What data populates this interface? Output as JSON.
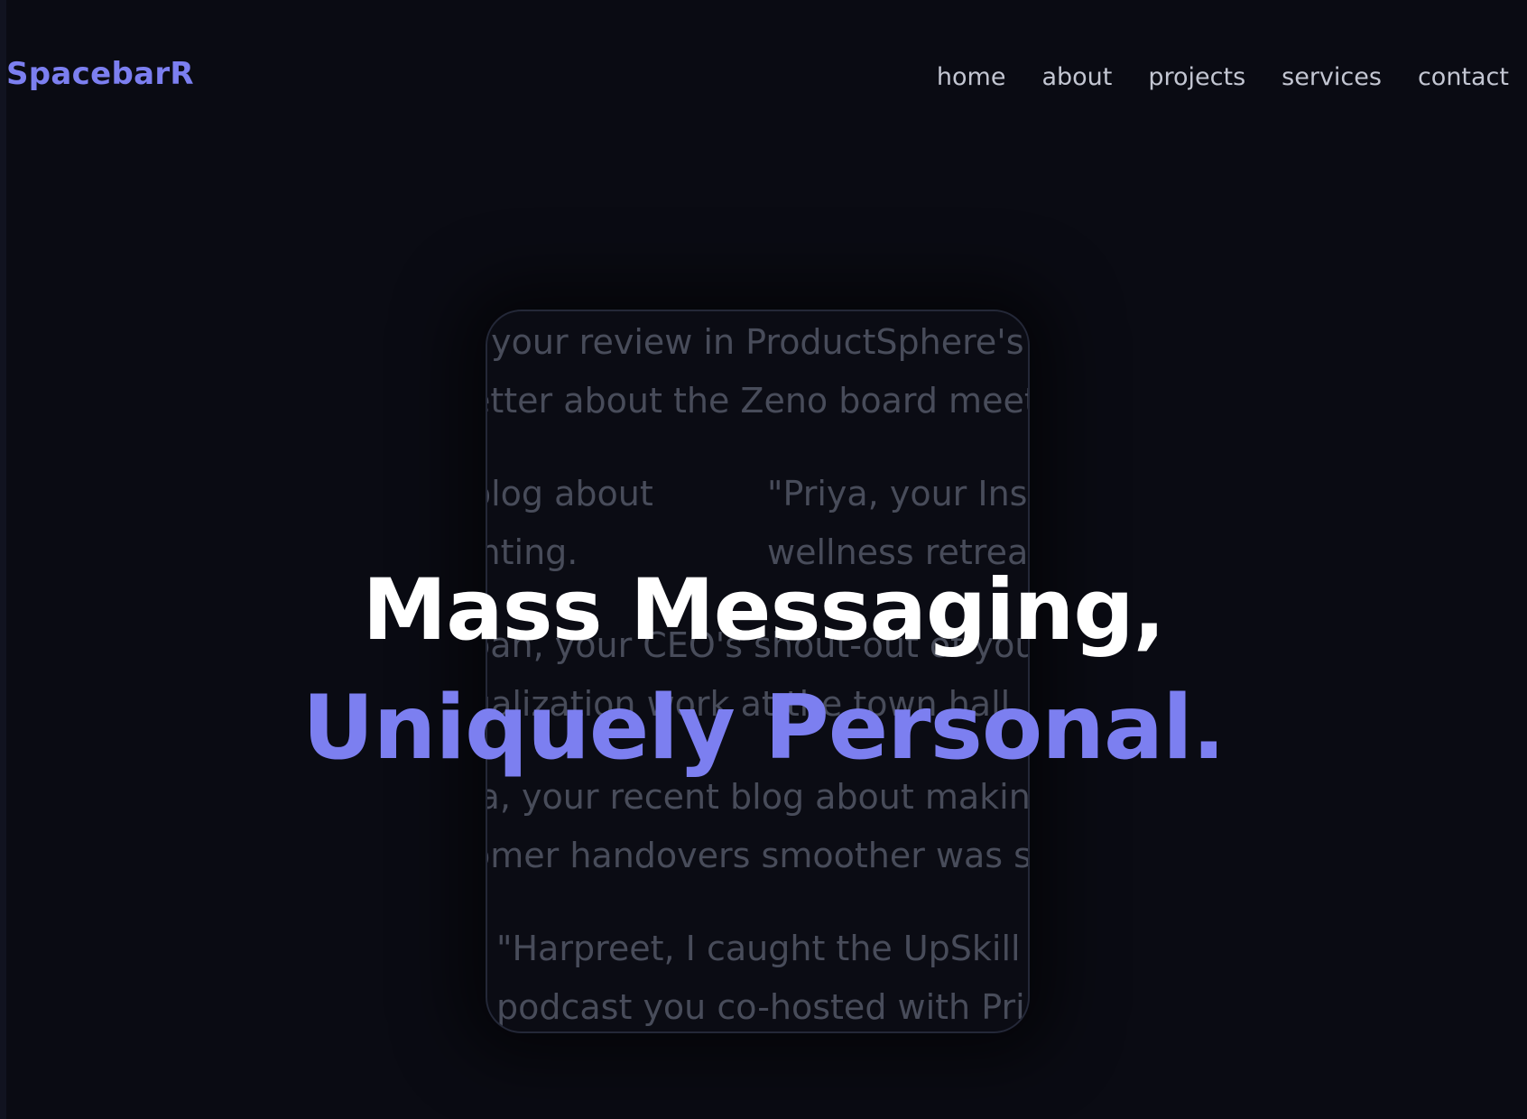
{
  "brand": {
    "name": "SpacebarR"
  },
  "nav": {
    "items": [
      "home",
      "about",
      "projects",
      "services",
      "contact"
    ]
  },
  "hero": {
    "line1": "Mass Messaging,",
    "line2": "Uniquely Personal.",
    "messages": [
      {
        "line1": ", your review in ProductSphere's",
        "line2": "etter about the Zeno board meet"
      },
      {
        "line1": "blog about",
        "line2": "inting."
      },
      {
        "line1": "\"Priya, your Ins",
        "line2": "wellness retrea"
      },
      {
        "line1": "oan, your CEO's shout-out of you",
        "line2": "ualization work at the town hall"
      },
      {
        "line1": "ia, your recent blog about makin",
        "line2": "omer handovers smoother was s"
      },
      {
        "line1": "\"Harpreet, I caught the UpSkill W",
        "line2": "podcast you co-hosted with Pri"
      }
    ]
  },
  "colors": {
    "background": "#0a0b13",
    "accent": "#7c7ff0",
    "nav_text": "#c3c6d2",
    "card_text": "#484c5a"
  }
}
